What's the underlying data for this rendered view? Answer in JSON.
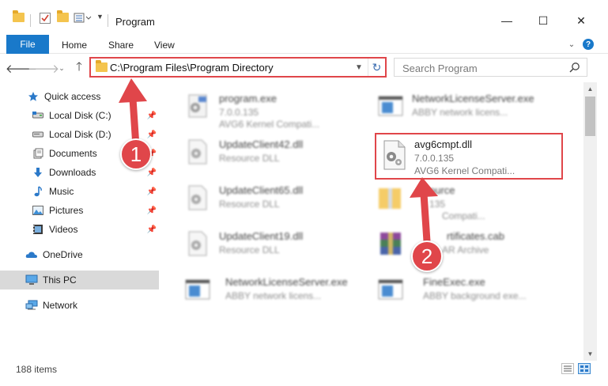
{
  "window": {
    "title": "Program",
    "minimize_glyph": "—",
    "maximize_glyph": "☐",
    "close_glyph": "✕"
  },
  "ribbon": {
    "file_label": "File",
    "tabs": [
      "Home",
      "Share",
      "View"
    ]
  },
  "address": {
    "path": "C:\\Program Files\\Program Directory",
    "search_placeholder": "Search Program"
  },
  "nav_pane": {
    "items": [
      {
        "label": "Quick access",
        "icon": "star-icon"
      },
      {
        "label": "Local Disk (C:)",
        "icon": "drive-icon",
        "pinned": true
      },
      {
        "label": "Local Disk (D:)",
        "icon": "drive-icon",
        "pinned": true
      },
      {
        "label": "Documents",
        "icon": "documents-icon",
        "pinned": true
      },
      {
        "label": "Downloads",
        "icon": "download-icon",
        "pinned": true
      },
      {
        "label": "Music",
        "icon": "music-icon",
        "pinned": true
      },
      {
        "label": "Pictures",
        "icon": "pictures-icon",
        "pinned": true
      },
      {
        "label": "Videos",
        "icon": "videos-icon",
        "pinned": true
      },
      {
        "label": "OneDrive",
        "icon": "cloud-icon"
      },
      {
        "label": "This PC",
        "icon": "computer-icon",
        "selected": true
      },
      {
        "label": "Network",
        "icon": "network-icon"
      }
    ]
  },
  "files": [
    {
      "name": "program.exe",
      "line2": "7.0.0.135",
      "line3": "AVG6 Kernel Compati...",
      "icon": "exe-gear-icon"
    },
    {
      "name": "NetworkLicenseServer.exe",
      "line2": "ABBY network licens...",
      "line3": "",
      "icon": "window-app-icon"
    },
    {
      "name": "UpdateClient42.dll",
      "line2": "Resource DLL",
      "line3": "",
      "icon": "dll-gear-icon"
    },
    {
      "name": "UpdateClient65.dll",
      "line2": "Resource DLL",
      "line3": "",
      "icon": "dll-gear-icon"
    },
    {
      "name": "ource",
      "line2": "135",
      "line3": "Compati...",
      "icon": "folder-zip-icon"
    },
    {
      "name": "UpdateClient19.dll",
      "line2": "Resource DLL",
      "line3": "",
      "icon": "dll-gear-icon"
    },
    {
      "name": "rtificates.cab",
      "line2": "AR Archive",
      "line3": "",
      "icon": "winrar-icon"
    },
    {
      "name": "NetworkLicenseServer.exe",
      "line2": "ABBY network licens...",
      "line3": "",
      "icon": "window-app-icon"
    },
    {
      "name": "FineExec.exe",
      "line2": "ABBY background exe...",
      "line3": "",
      "icon": "window-app-icon"
    }
  ],
  "highlighted_file": {
    "name": "avg6cmpt.dll",
    "line2": "7.0.0.135",
    "line3": "AVG6 Kernel Compati..."
  },
  "callouts": [
    "1",
    "2"
  ],
  "status": {
    "item_count": "188 items"
  },
  "colors": {
    "accent_blue": "#1979ca",
    "annotation_red": "#e0464a",
    "folder_yellow": "#f4c44e",
    "selected_gray": "#d9d9d9"
  }
}
